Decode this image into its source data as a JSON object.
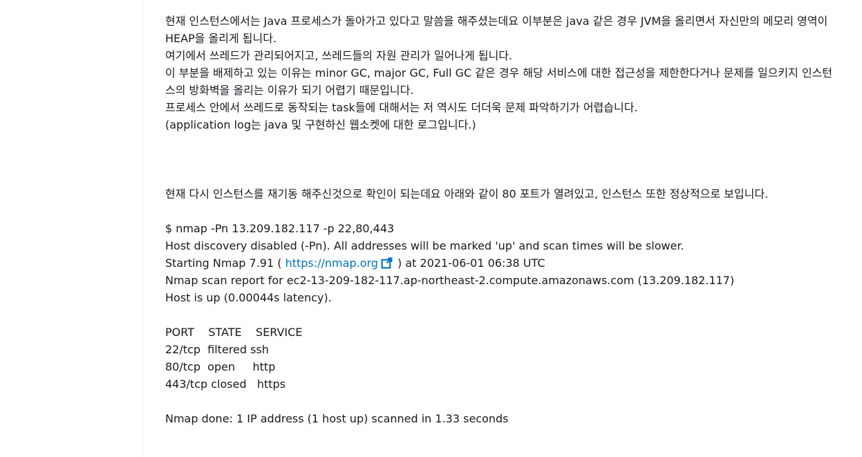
{
  "paragraphs": {
    "p1": "현재 인스턴스에서는 Java 프로세스가 돌아가고 있다고 말씀을 해주셨는데요 이부분은 java 같은 경우 JVM을 올리면서 자신만의 메모리 영역이 HEAP을 올리게 됩니다.",
    "p2": "여기에서 쓰레드가 관리되어지고, 쓰레드들의 자원 관리가 일어나게 됩니다.",
    "p3": "이 부분을 배제하고 있는 이유는 minor GC, major GC, Full GC 같은 경우 해당 서비스에 대한 접근성을 제한한다거나 문제를 일으키지 인스턴스의 방화벽을 올리는 이유가 되기 어렵기 때문입니다.",
    "p4": "프로세스 안에서 쓰레드로 동작되는 task들에 대해서는 저 역시도 더더욱 문제 파악하기가 어렵습니다.",
    "p5": "(application log는 java 및 구현하신 웹소켓에 대한 로그입니다.)",
    "p6": "현재 다시 인스턴스를 재기동 해주신것으로 확인이 되는데요 아래와 같이 80 포트가 열려있고, 인스턴스 또한 정상적으로 보입니다."
  },
  "nmap": {
    "command": "$ nmap -Pn 13.209.182.117 -p 22,80,443",
    "discovery": "Host discovery disabled (-Pn). All addresses will be marked 'up' and scan times will be slower.",
    "starting_prefix": "Starting Nmap 7.91 ( ",
    "starting_link": "https://nmap.org",
    "starting_suffix": " ) at 2021-06-01 06:38 UTC",
    "report": "Nmap scan report for ec2-13-209-182-117.ap-northeast-2.compute.amazonaws.com (13.209.182.117)",
    "host_up": "Host is up (0.00044s latency).",
    "table_header": "PORT    STATE    SERVICE",
    "rows": [
      "22/tcp  filtered ssh",
      "80/tcp  open     http",
      "443/tcp closed   https"
    ],
    "done": "Nmap done: 1 IP address (1 host up) scanned in 1.33 seconds"
  },
  "icons": {
    "external_link": "external-link-icon"
  },
  "colors": {
    "link": "#0073bb",
    "text": "#16191f"
  }
}
